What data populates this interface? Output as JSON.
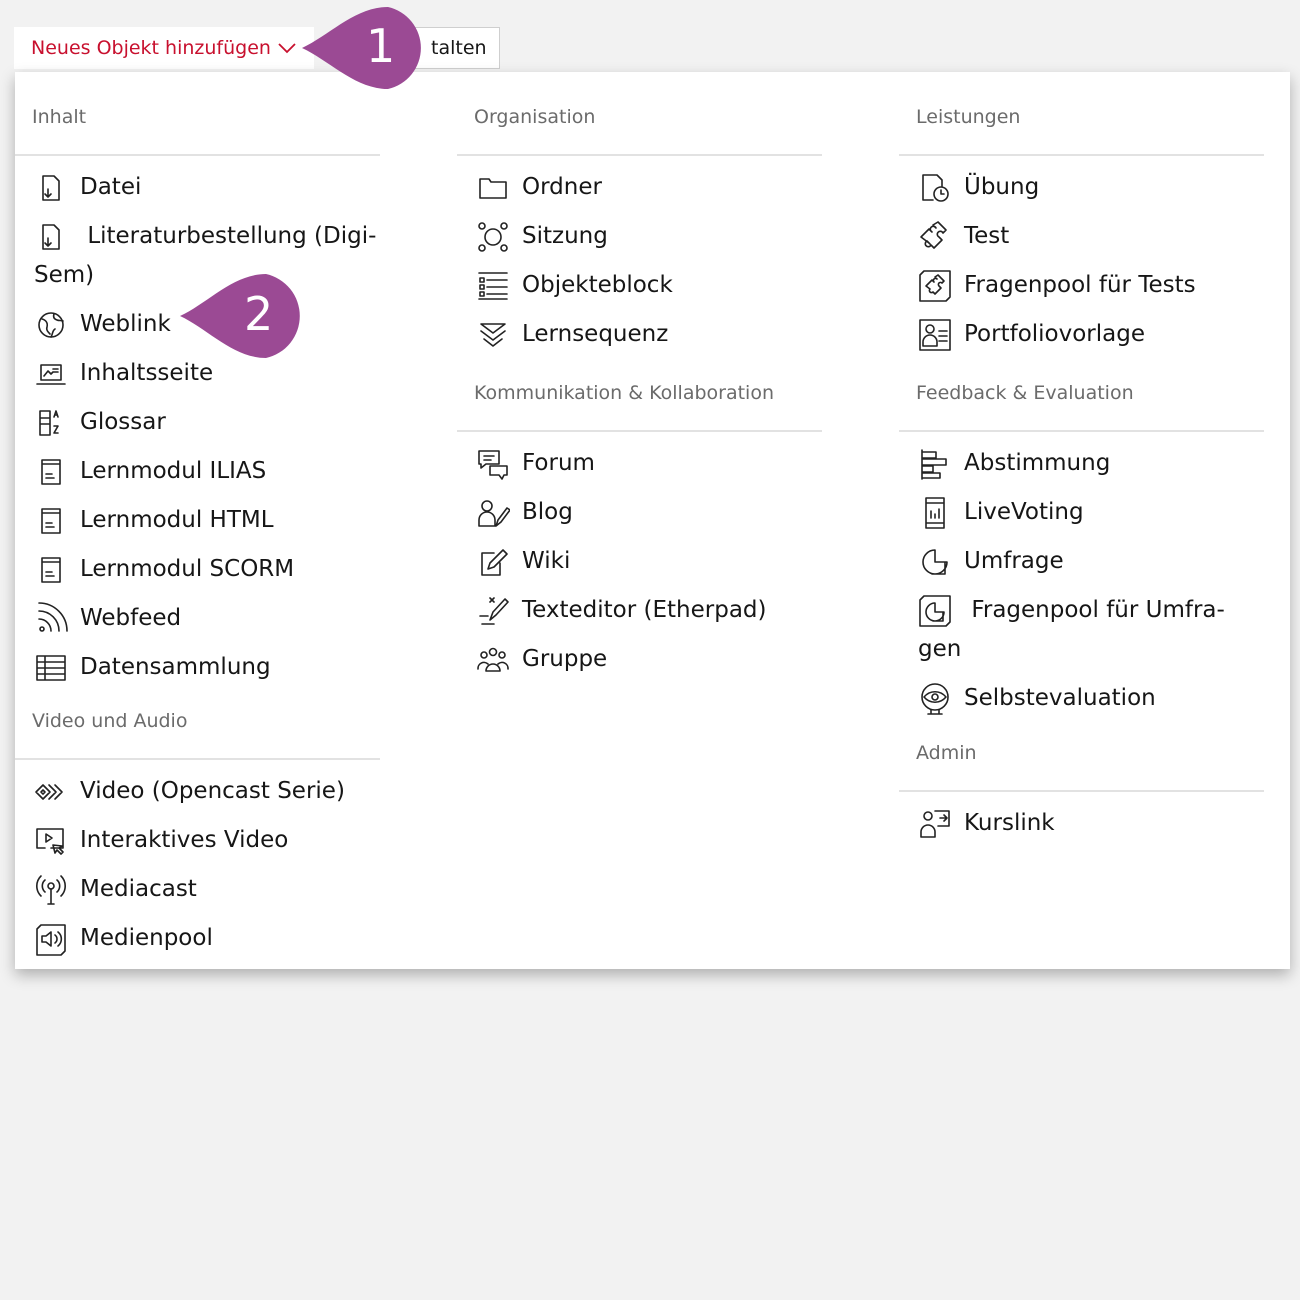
{
  "toolbar": {
    "add_label": "Neues Objekt hinzufügen",
    "design_label": "talten"
  },
  "menu": {
    "inhalt": {
      "title": "Inhalt",
      "items": [
        "Datei",
        "Literaturbestellung (Digi-Sem)",
        "Weblink",
        "Inhaltsseite",
        "Glossar",
        "Lernmodul ILIAS",
        "Lernmodul HTML",
        "Lernmodul SCORM",
        "Webfeed",
        "Datensammlung"
      ]
    },
    "video": {
      "title": "Video und Audio",
      "items": [
        "Video (Opencast Serie)",
        "Interaktives Video",
        "Mediacast",
        "Medienpool"
      ]
    },
    "organisation": {
      "title": "Organisation",
      "items": [
        "Ordner",
        "Sitzung",
        "Objekteblock",
        "Lernsequenz"
      ]
    },
    "kommunikation": {
      "title": "Kommunikation & Kollaboration",
      "items": [
        "Forum",
        "Blog",
        "Wiki",
        "Texteditor (Etherpad)",
        "Gruppe"
      ]
    },
    "leistungen": {
      "title": "Leistungen",
      "items": [
        "Übung",
        "Test",
        "Fragenpool für Tests",
        "Portfoliovorlage"
      ]
    },
    "feedback": {
      "title": "Feedback & Evaluation",
      "items": [
        "Abstimmung",
        "LiveVoting",
        "Umfrage",
        "Fragenpool für Umfra-gen",
        "Selbstevaluation"
      ]
    },
    "admin": {
      "title": "Admin",
      "items": [
        "Kurslink"
      ]
    }
  },
  "callouts": [
    "1",
    "2"
  ],
  "colors": {
    "accent": "#c8102e",
    "callout": "#9b4a94"
  }
}
